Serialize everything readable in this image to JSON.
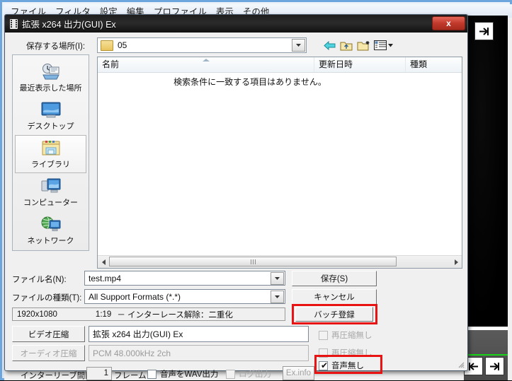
{
  "app": {
    "menu": [
      {
        "label": "ファイル"
      },
      {
        "label": "フィルタ"
      },
      {
        "label": "設定"
      },
      {
        "label": "編集"
      },
      {
        "label": "プロファイル"
      },
      {
        "label": "表示"
      },
      {
        "label": "その他"
      }
    ]
  },
  "dialog": {
    "title": "拡張 x264 出力(GUI) Ex",
    "close_label": "x",
    "save_in_label": "保存する場所(I):",
    "location_value": "05",
    "toolbar": [
      {
        "name": "back-icon"
      },
      {
        "name": "up-folder-icon"
      },
      {
        "name": "new-folder-icon"
      },
      {
        "name": "views-icon"
      }
    ],
    "places": [
      {
        "label": "最近表示した場所",
        "icon": "recent-places-icon",
        "selected": false
      },
      {
        "label": "デスクトップ",
        "icon": "desktop-icon",
        "selected": false
      },
      {
        "label": "ライブラリ",
        "icon": "library-folder-icon",
        "selected": true
      },
      {
        "label": "コンピューター",
        "icon": "computer-icon",
        "selected": false
      },
      {
        "label": "ネットワーク",
        "icon": "network-icon",
        "selected": false
      }
    ],
    "columns": [
      "名前",
      "更新日時",
      "種類"
    ],
    "empty_message": "検索条件に一致する項目はありません。",
    "filename_label": "ファイル名(N):",
    "filename_value": "test.mp4",
    "filetype_label": "ファイルの種類(T):",
    "filetype_value": "All Support Formats (*.*)",
    "save_button": "保存(S)",
    "cancel_button": "キャンセル",
    "info_resolution": "1920x1080",
    "info_duration": "1:19",
    "info_deinterlace": "－  インターレース解除：二重化",
    "batch_button": "バッチ登録",
    "video_compress_button": "ビデオ圧縮",
    "video_codec_value": "拡張 x264 出力(GUI) Ex",
    "audio_compress_button": "オーディオ圧縮",
    "audio_codec_value": "PCM 48.000kHz 2ch",
    "no_recompress_1": "再圧縮無し",
    "no_recompress_2": "再圧縮無し",
    "no_audio_label": "音声無し",
    "interleave_label": "インターリーブ間隔：",
    "interleave_value": "1",
    "frame_unit": "フレーム",
    "wav_output_label": "音声をWAV出力",
    "log_output_label": "ログ出力",
    "exinfo_button": "Ex.info"
  },
  "colors": {
    "highlight": "#e81313",
    "title_bar": "#1d1d1d",
    "close_red": "#c0392b",
    "timeline_green": "#18d318"
  }
}
